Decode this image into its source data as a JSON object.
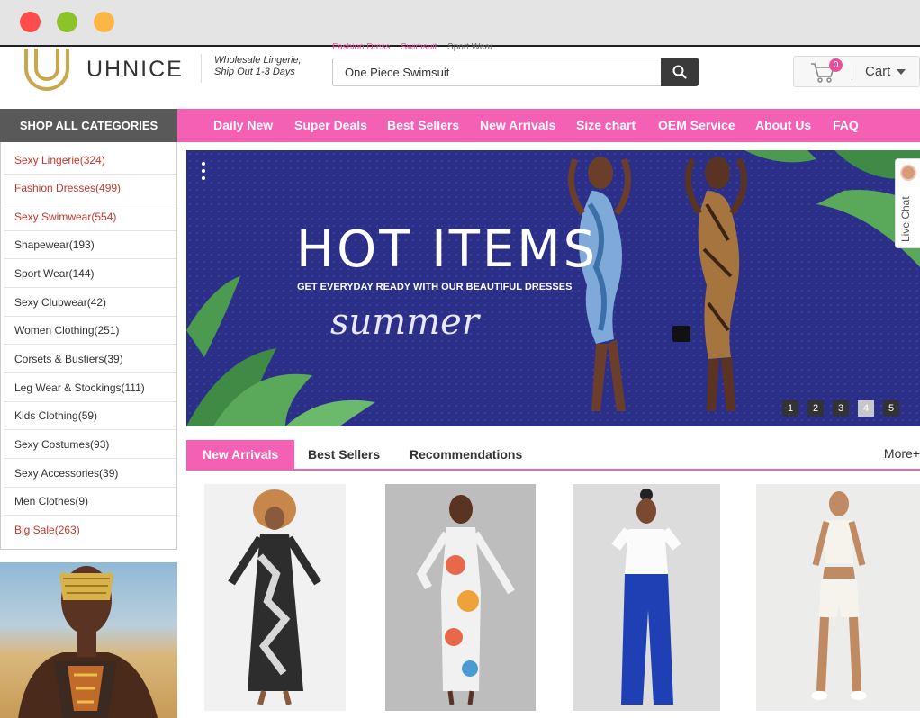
{
  "header": {
    "logo_text": "UHNICE",
    "tagline_line1": "Wholesale Lingerie,",
    "tagline_line2": "Ship Out 1-3 Days",
    "hot_searches": [
      "Fashion Dress",
      "Swimsuit",
      "Sport Wear"
    ],
    "search_value": "One Piece Swimsuit",
    "cart_count": "0",
    "cart_label": "Cart"
  },
  "nav": {
    "categories_button": "SHOP ALL CATEGORIES",
    "items": [
      "Daily New",
      "Super Deals",
      "Best Sellers",
      "New Arrivals",
      "Size chart",
      "OEM Service",
      "About Us",
      "FAQ"
    ]
  },
  "sidebar": {
    "items": [
      {
        "label": "Sexy Lingerie(324)"
      },
      {
        "label": "Fashion Dresses(499)"
      },
      {
        "label": "Sexy Swimwear(554)"
      },
      {
        "label": "Shapewear(193)"
      },
      {
        "label": "Sport Wear(144)"
      },
      {
        "label": "Sexy Clubwear(42)"
      },
      {
        "label": "Women Clothing(251)"
      },
      {
        "label": "Corsets & Bustiers(39)"
      },
      {
        "label": "Leg Wear & Stockings(111)"
      },
      {
        "label": "Kids Clothing(59)"
      },
      {
        "label": "Sexy Costumes(93)"
      },
      {
        "label": "Sexy Accessories(39)"
      },
      {
        "label": "Men Clothes(9)"
      },
      {
        "label": "Big Sale(263)"
      }
    ]
  },
  "banner": {
    "title": "HOT ITEMS",
    "subtitle": "GET EVERYDAY READY WITH OUR BEAUTIFUL DRESSES",
    "script": "summer",
    "slides": [
      "1",
      "2",
      "3",
      "4",
      "5"
    ],
    "active_slide": "4"
  },
  "live_chat": "Live Chat",
  "tabs": {
    "items": [
      "New Arrivals",
      "Best Sellers",
      "Recommendations"
    ],
    "more": "More+"
  },
  "colors": {
    "accent_pink": "#f460b4",
    "category_red": "#c0392b",
    "banner_blue": "#2b2f88"
  }
}
